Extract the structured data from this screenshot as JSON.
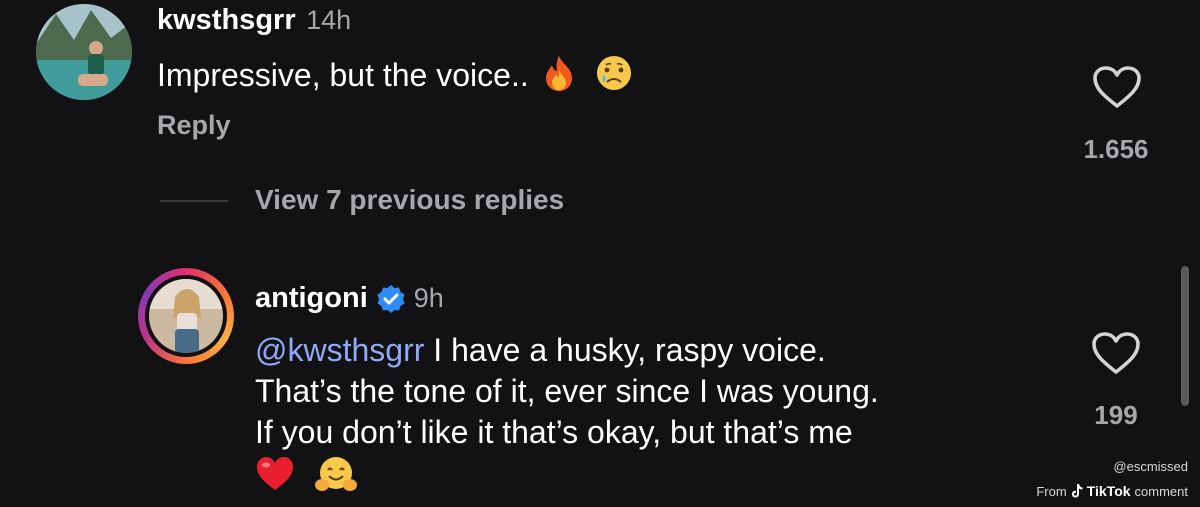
{
  "comments": [
    {
      "username": "kwsthsgrr",
      "time": "14h",
      "text": "Impressive, but the voice..",
      "emojis": [
        "fire-emoji",
        "crying-face-emoji"
      ],
      "reply_label": "Reply",
      "likes": "1.656",
      "verified": false
    },
    {
      "username": "antigoni",
      "time": "9h",
      "mention": "@kwsthsgrr",
      "text_line1": " I have a husky, raspy voice.",
      "text_line2": "That’s the tone of it, ever since I was young.",
      "text_line3": "If you don’t like it that’s okay, but that’s me",
      "emojis": [
        "red-heart-emoji",
        "hugging-face-emoji"
      ],
      "likes": "199",
      "verified": true
    }
  ],
  "view_replies_label": "View 7 previous replies",
  "watermark": {
    "handle": "@escmissed",
    "from": "From",
    "brand": "TikTok",
    "suffix": "comment"
  },
  "colors": {
    "background": "#121214",
    "mention": "#8eaaf6",
    "muted_text": "#a7a7ab",
    "verified_badge": "#2f8cf5"
  }
}
